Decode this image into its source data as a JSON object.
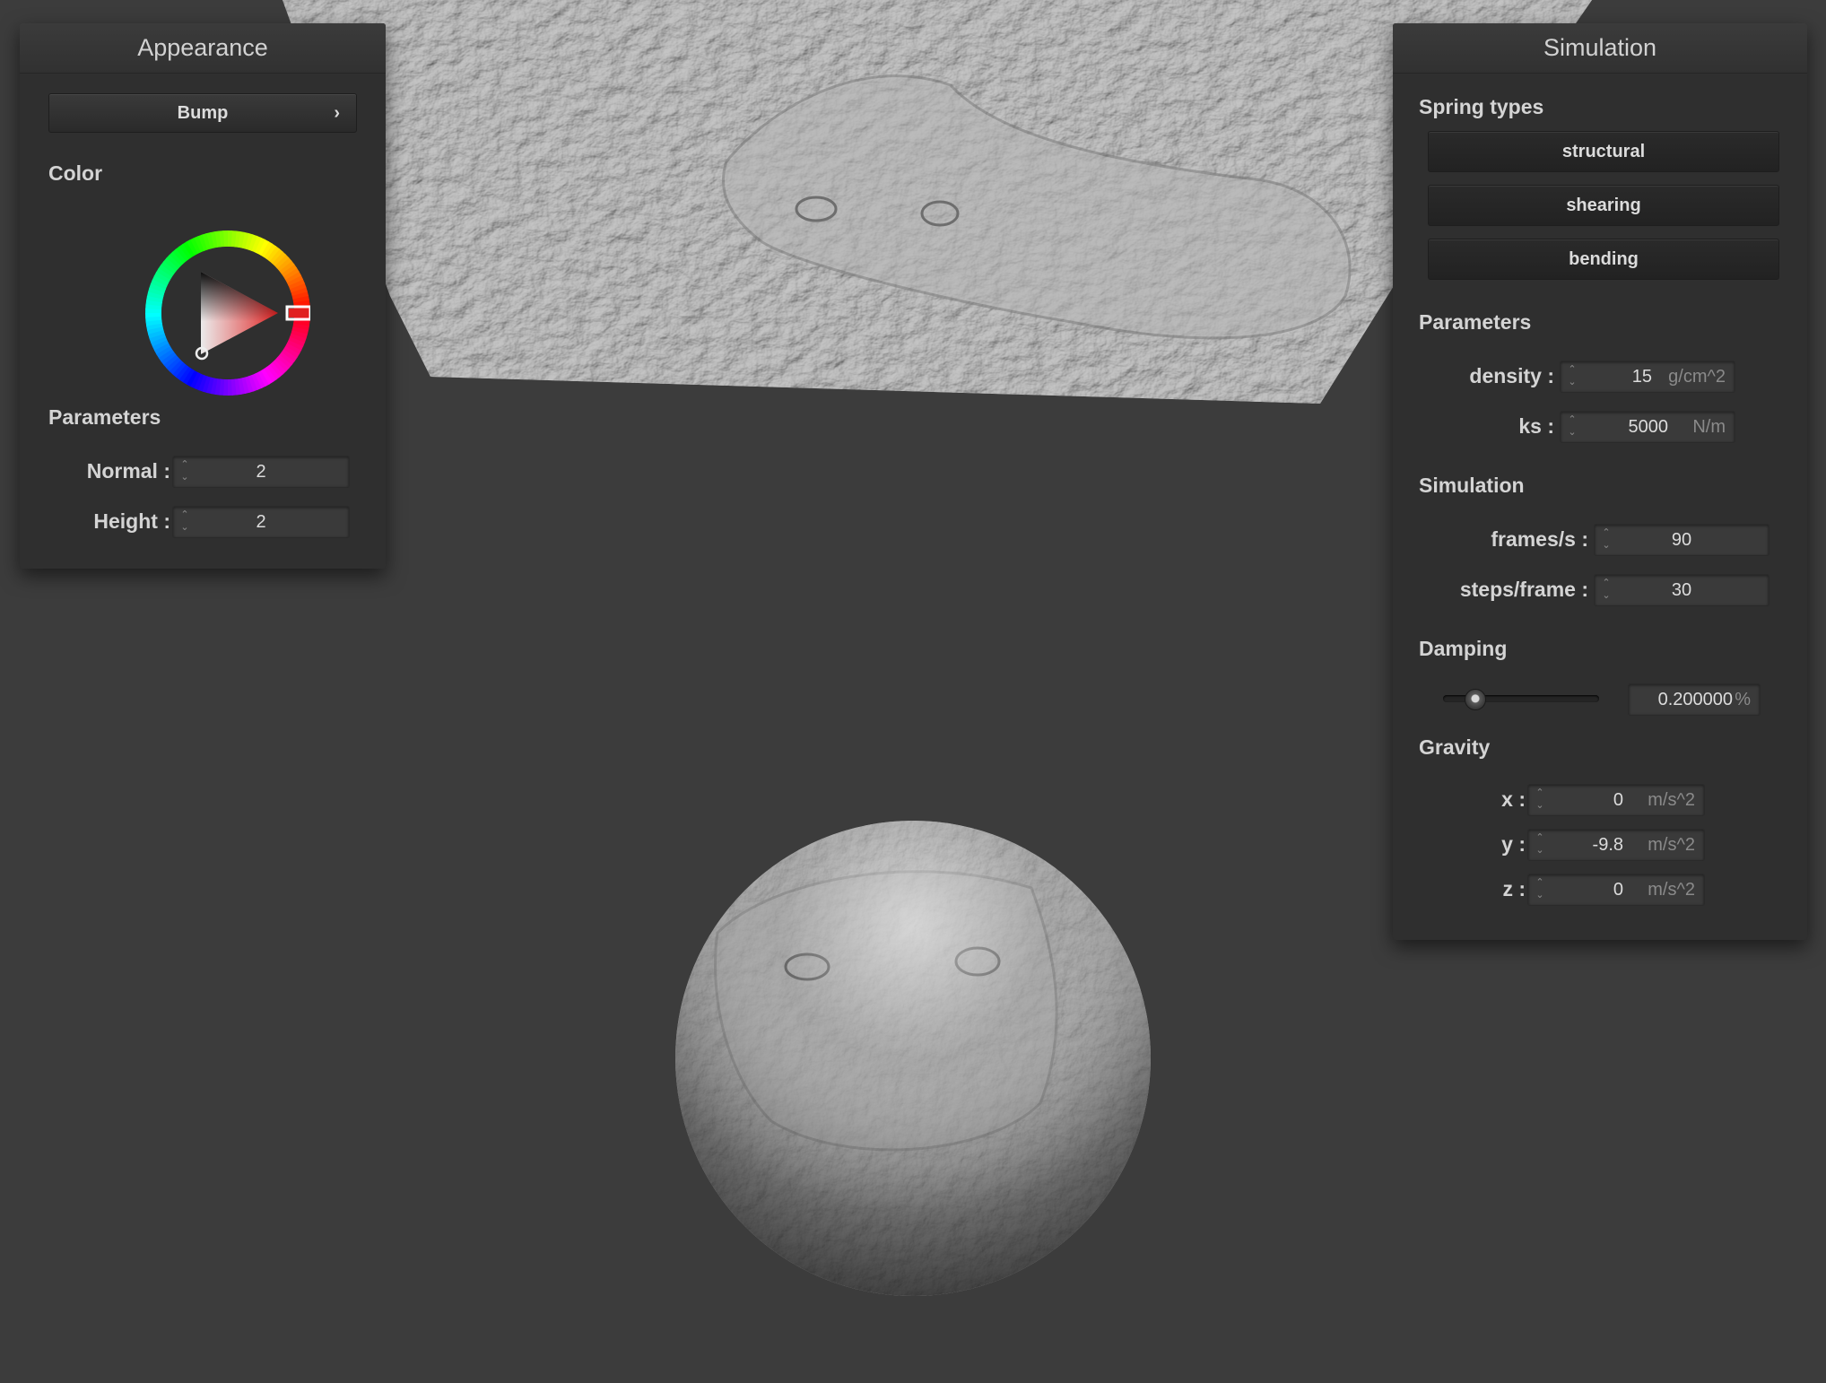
{
  "appearance": {
    "title": "Appearance",
    "shader_button": "Bump",
    "shader_chevron": "›",
    "color_label": "Color",
    "accent_color": "#e02020",
    "parameters_label": "Parameters",
    "normal_label": "Normal :",
    "normal_value": "2",
    "height_label": "Height :",
    "height_value": "2"
  },
  "simulation": {
    "title": "Simulation",
    "spring_types_label": "Spring types",
    "springs": [
      "structural",
      "shearing",
      "bending"
    ],
    "parameters_label": "Parameters",
    "density_label": "density :",
    "density_value": "15",
    "density_unit": "g/cm^2",
    "ks_label": "ks :",
    "ks_value": "5000",
    "ks_unit": "N/m",
    "simulation_label": "Simulation",
    "fps_label": "frames/s :",
    "fps_value": "90",
    "steps_label": "steps/frame :",
    "steps_value": "30",
    "damping_label": "Damping",
    "damping_value": "0.200000",
    "damping_unit": "%",
    "damping_slider_fraction": 0.2,
    "gravity_label": "Gravity",
    "gx_label": "x :",
    "gx_value": "0",
    "gy_label": "y :",
    "gy_value": "-9.8",
    "gz_label": "z :",
    "gz_value": "0",
    "g_unit": "m/s^2"
  },
  "spin_arrows": "⌃⌄"
}
